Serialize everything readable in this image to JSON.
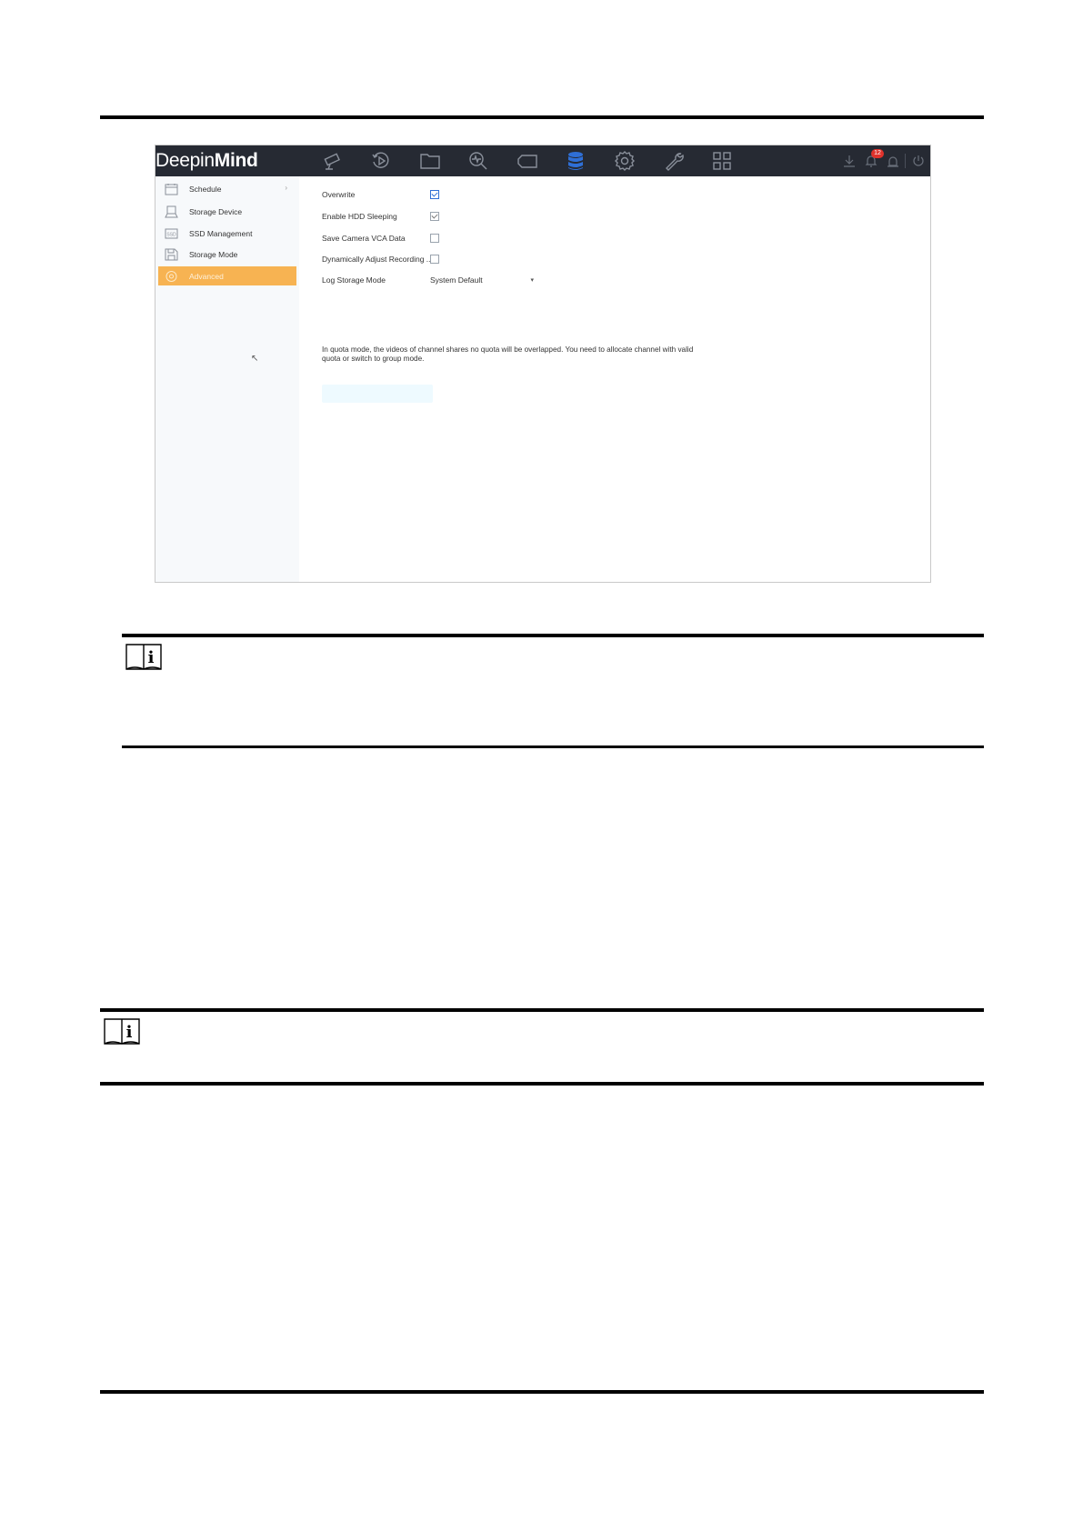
{
  "app": {
    "brand_regular": "Deepin",
    "brand_bold": "Mind",
    "nav_icons": [
      "camera-icon",
      "playback-icon",
      "folder-icon",
      "search-activity-icon",
      "ptz-icon",
      "storage-icon",
      "settings-icon",
      "maintenance-icon",
      "grid-icon"
    ],
    "active_nav": "storage-icon",
    "status_icons": [
      "download-icon",
      "notification-icon",
      "alarm-icon",
      "power-icon"
    ],
    "notification_count": "12",
    "colors": {
      "topbar": "#262a33",
      "accent": "#f7b352",
      "active_icon": "#2f6fd6",
      "badge": "#e0322b"
    }
  },
  "sidebar": {
    "items": [
      {
        "label": "Schedule",
        "icon": "calendar-icon"
      },
      {
        "label": "Storage Device",
        "icon": "storage-device-icon"
      },
      {
        "label": "SSD Management",
        "icon": "ssd-icon"
      },
      {
        "label": "Storage Mode",
        "icon": "floppy-icon"
      },
      {
        "label": "Advanced",
        "icon": "advanced-gear-icon",
        "active": true
      }
    ]
  },
  "settings": {
    "overwrite_label": "Overwrite",
    "overwrite_checked": true,
    "hdd_sleep_label": "Enable HDD Sleeping",
    "hdd_sleep_checked": true,
    "vca_label": "Save Camera VCA Data",
    "vca_checked": false,
    "dynamic_label": "Dynamically Adjust Recording ...",
    "dynamic_checked": false,
    "log_mode_label": "Log Storage Mode",
    "log_mode_value": "System Default"
  },
  "notice": "In quota mode, the videos of channel shares no quota will be overlapped. You need to allocate channel with valid quota or switch to group mode."
}
